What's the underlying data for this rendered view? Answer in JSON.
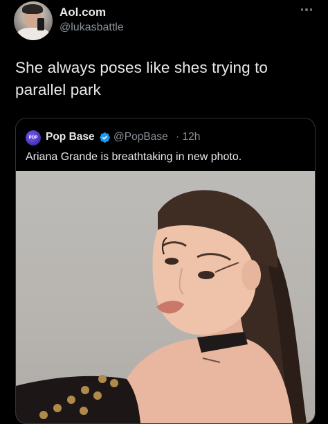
{
  "tweet": {
    "display_name": "Aol.com",
    "handle": "@lukasbattle",
    "text": "She always poses like shes trying to parallel park",
    "more_icon": "more-horizontal-icon"
  },
  "quote": {
    "name": "Pop Base",
    "verified_icon": "verified-badge-icon",
    "verified_color": "#1d9bf0",
    "handle": "@PopBase",
    "time": "· 12h",
    "text": "Ariana Grande is breathtaking in new photo.",
    "avatar_label": "POP"
  },
  "colors": {
    "background": "#000000",
    "text_primary": "#e7e9ea",
    "text_secondary": "#8b9299",
    "border": "#2f3336"
  }
}
